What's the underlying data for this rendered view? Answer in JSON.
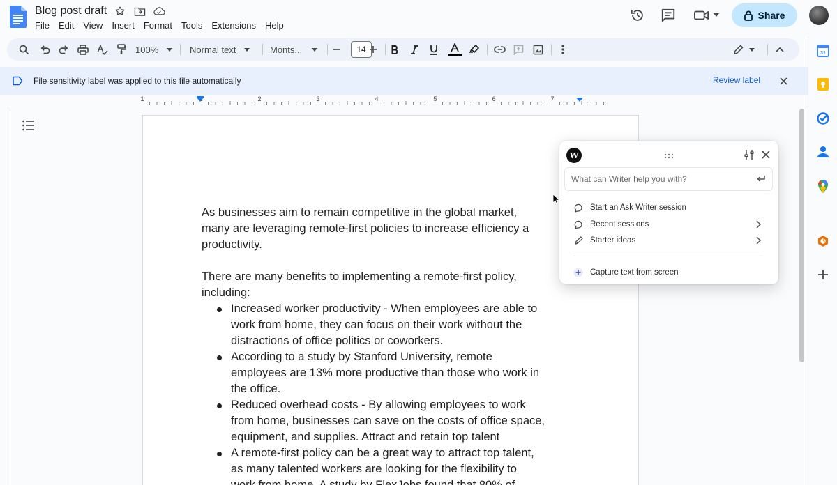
{
  "header": {
    "doc_title": "Blog post draft",
    "menu": [
      "File",
      "Edit",
      "View",
      "Insert",
      "Format",
      "Tools",
      "Extensions",
      "Help"
    ],
    "share_label": "Share"
  },
  "toolbar": {
    "zoom": "100%",
    "style": "Normal text",
    "font": "Monts...",
    "font_size": "14"
  },
  "banner": {
    "text": "File sensitivity label was applied to this file automatically",
    "link": "Review label"
  },
  "ruler": {
    "labels": [
      "1",
      "1",
      "2",
      "3",
      "4",
      "5",
      "6",
      "7"
    ]
  },
  "document": {
    "para1": "As businesses aim to remain competitive in the global market,\nmany are leveraging remote-first policies to increase efficiency a\nproductivity.",
    "para2": "There are many benefits to implementing a remote-first policy,\nincluding:",
    "bullets": [
      "Increased worker productivity - When employees are able to\nwork from home, they can focus on their work without the\ndistractions of office politics or coworkers.",
      "According to a study by Stanford University, remote\nemployees are 13% more productive than those who work in\nthe office.",
      "Reduced overhead costs - By allowing employees to work\nfrom home, businesses can save on the costs of office space,\nequipment, and supplies. Attract and retain top talent",
      "A remote-first policy can be a great way to attract top talent,\nas many talented workers are looking for the flexibility to\nwork from home. A study by FlexJobs found that 80% of"
    ]
  },
  "writer": {
    "logo": "W",
    "placeholder": "What can Writer help you with?",
    "items": [
      {
        "label": "Start an Ask Writer session",
        "icon": "chat-bubble-icon"
      },
      {
        "label": "Recent sessions",
        "icon": "chat-bubble-icon"
      },
      {
        "label": "Starter ideas",
        "icon": "pencil-icon"
      }
    ],
    "capture_label": "Capture text from screen"
  },
  "colors": {
    "share_bg": "#c2e7ff",
    "banner_bg": "#e8f0fe",
    "link": "#0b57d0",
    "docs_blue": "#4285f4"
  }
}
